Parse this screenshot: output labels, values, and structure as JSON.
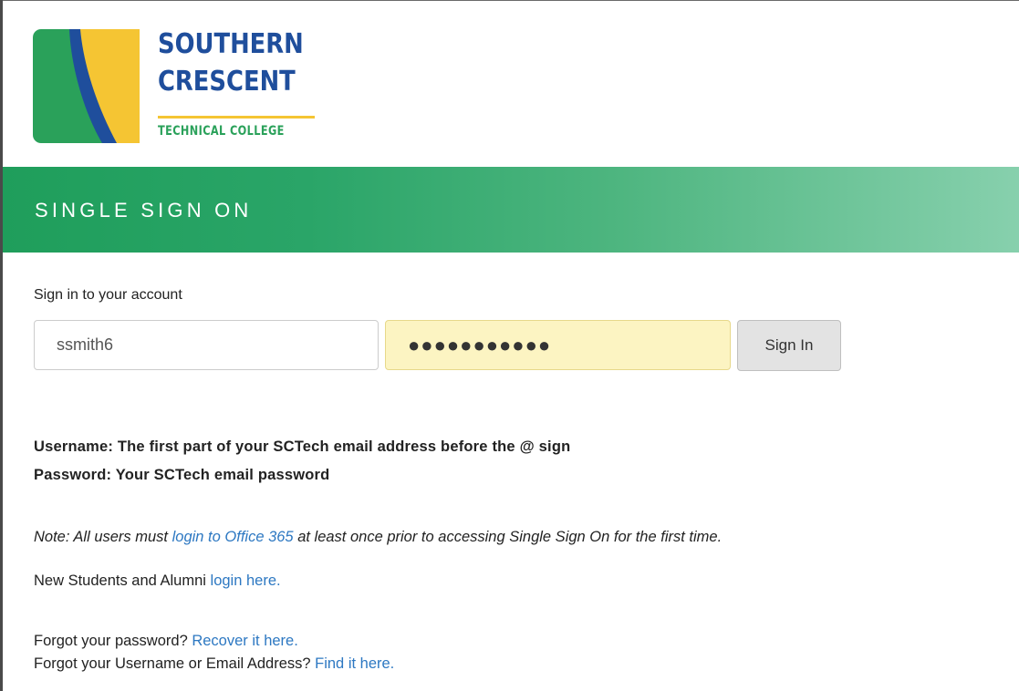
{
  "logo": {
    "line1": "SOUTHERN",
    "line2": "CRESCENT",
    "line3": "TECHNICAL COLLEGE",
    "colors": {
      "green": "#2aa15a",
      "blue": "#1f4e9c",
      "yellow": "#f5c533"
    }
  },
  "banner": {
    "title": "SINGLE SIGN ON",
    "color_start": "#1f9e5b",
    "color_end": "#87d0ad"
  },
  "form": {
    "heading": "Sign in to your account",
    "username_value": "ssmith6",
    "password_value": "●●●●●●●●●●●",
    "submit_label": "Sign In"
  },
  "help": {
    "username_text": "Username: The first part of your SCTech email address before the @ sign",
    "password_text": "Password: Your SCTech email password",
    "note_prefix": "Note: All users must ",
    "note_link": "login to Office 365",
    "note_suffix": " at least once prior to accessing Single Sign On for the first time.",
    "new_students_prefix": "New Students and Alumni ",
    "new_students_link": "login here.",
    "forgot_password_prefix": "Forgot your password? ",
    "forgot_password_link": "Recover it here.",
    "forgot_username_prefix": "Forgot your Username or Email Address? ",
    "forgot_username_link": "Find it here."
  },
  "colors": {
    "link": "#2d78c2",
    "autofill": "#fcf4c2"
  }
}
